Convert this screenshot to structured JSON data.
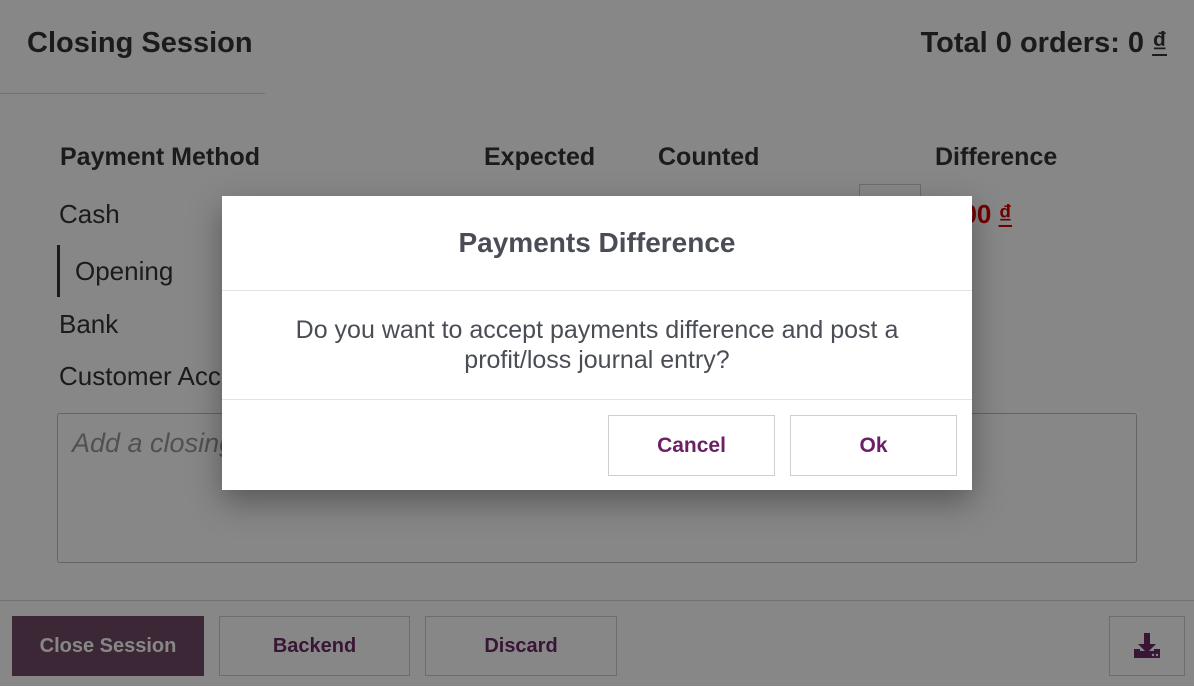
{
  "header": {
    "title": "Closing Session",
    "total_label": "Total 0 orders: 0",
    "currency": "₫"
  },
  "table": {
    "headers": {
      "payment_method": "Payment Method",
      "expected": "Expected",
      "counted": "Counted",
      "difference": "Difference"
    },
    "rows": {
      "cash": "Cash",
      "opening": "Opening",
      "bank": "Bank",
      "customer_account": "Customer Acc"
    },
    "cash_difference_value": "000",
    "cash_difference_currency": "₫"
  },
  "notes": {
    "placeholder": "Add a closing"
  },
  "footer": {
    "close_session": "Close Session",
    "backend": "Backend",
    "discard": "Discard",
    "download_icon": "download-icon"
  },
  "modal": {
    "title": "Payments Difference",
    "body": "Do you want to accept payments difference and post a profit/loss journal entry?",
    "cancel": "Cancel",
    "ok": "Ok"
  },
  "colors": {
    "brand": "#714b67",
    "button_text": "#6c2a64",
    "negative": "#d40000"
  }
}
